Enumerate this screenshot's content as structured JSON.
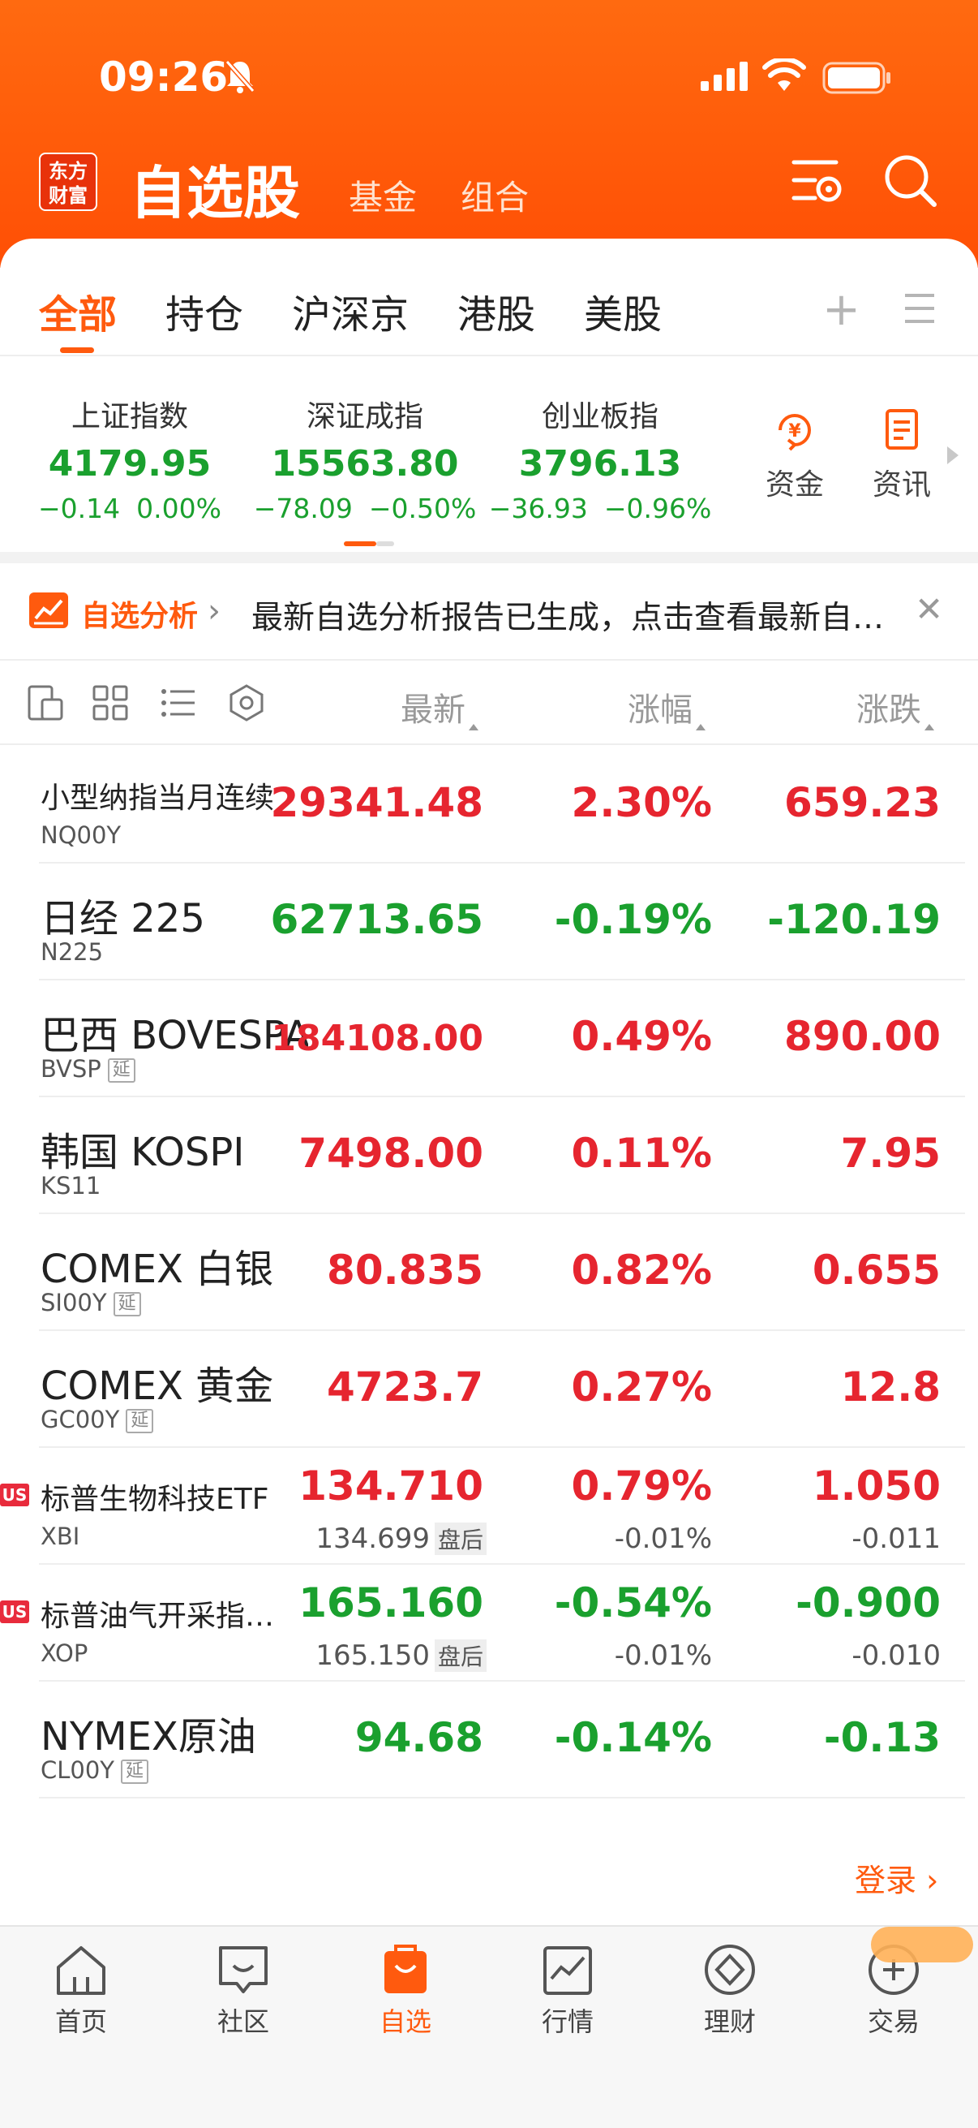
{
  "status": {
    "time": "09:26"
  },
  "header": {
    "logo_line1": "东方",
    "logo_line2": "财富",
    "title": "自选股",
    "tab_fund": "基金",
    "tab_portfolio": "组合"
  },
  "tabs": [
    "全部",
    "持仓",
    "沪深京",
    "港股",
    "美股"
  ],
  "indices": [
    {
      "name": "上证指数",
      "value": "4179.95",
      "change": "−0.14",
      "pct": "0.00%"
    },
    {
      "name": "深证成指",
      "value": "15563.80",
      "change": "−78.09",
      "pct": "−0.50%"
    },
    {
      "name": "创业板指",
      "value": "3796.13",
      "change": "−36.93",
      "pct": "−0.96%"
    }
  ],
  "quick_links": {
    "funds": "资金",
    "news": "资讯"
  },
  "banner": {
    "title": "自选分析",
    "text": "最新自选分析报告已生成，点击查看最新自选分析报告"
  },
  "columns": {
    "latest": "最新",
    "change_pct": "涨幅",
    "change": "涨跌"
  },
  "rows": [
    {
      "name": "小型纳指当月连续",
      "code": "NQ00Y",
      "price": "29341.48",
      "pct": "2.30%",
      "chg": "659.23"
    },
    {
      "name": "日经 225",
      "code": "N225",
      "price": "62713.65",
      "pct": "-0.19%",
      "chg": "-120.19"
    },
    {
      "name": "巴西 BOVESPA",
      "code": "BVSP",
      "delay": "延",
      "price": "184108.00",
      "pct": "0.49%",
      "chg": "890.00"
    },
    {
      "name": "韩国 KOSPI",
      "code": "KS11",
      "price": "7498.00",
      "pct": "0.11%",
      "chg": "7.95"
    },
    {
      "name": "COMEX 白银",
      "code": "SI00Y",
      "delay": "延",
      "price": "80.835",
      "pct": "0.82%",
      "chg": "0.655"
    },
    {
      "name": "COMEX 黄金",
      "code": "GC00Y",
      "delay": "延",
      "price": "4723.7",
      "pct": "0.27%",
      "chg": "12.8"
    },
    {
      "badge": "US",
      "name": "标普生物科技ETF",
      "code": "XBI",
      "price": "134.710",
      "pct": "0.79%",
      "chg": "1.050",
      "after_price": "134.699",
      "after_tag": "盘后",
      "after_pct": "-0.01%",
      "after_chg": "-0.011"
    },
    {
      "badge": "US",
      "name": "标普油气开采指数ETF",
      "code": "XOP",
      "price": "165.160",
      "pct": "-0.54%",
      "chg": "-0.900",
      "after_price": "165.150",
      "after_tag": "盘后",
      "after_pct": "-0.01%",
      "after_chg": "-0.010"
    },
    {
      "name": "NYMEX原油",
      "code": "CL00Y",
      "delay": "延",
      "price": "94.68",
      "pct": "-0.14%",
      "chg": "-0.13"
    }
  ],
  "login": "登录",
  "nav": [
    "首页",
    "社区",
    "自选",
    "行情",
    "理财",
    "交易"
  ],
  "colors": {
    "brand": "#ff5a0e",
    "up": "#e6252f",
    "down": "#1aa02e"
  }
}
